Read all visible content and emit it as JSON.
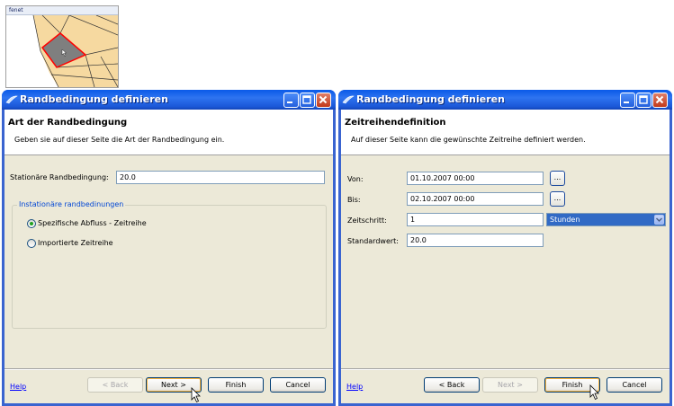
{
  "map": {
    "title": "fenet"
  },
  "colors": {
    "title_bar": "#2e74f0",
    "map_fill": "#f6d9a0",
    "selected_poly": "#7f7f7f",
    "selected_border": "#ff0000"
  },
  "left_dialog": {
    "title": "Randbedingung definieren",
    "header_title": "Art der Randbedingung",
    "header_desc": "Geben sie auf dieser Seite die Art der Randbedingung ein.",
    "stationary_label": "Stationäre Randbedingung:",
    "stationary_value": "20.0",
    "group_label": "Instationäre randbedinungen",
    "radio1": "Spezifische Abfluss - Zeitreihe",
    "radio2": "Importierte Zeitreihe",
    "help": "Help",
    "back": "< Back",
    "next": "Next >",
    "finish": "Finish",
    "cancel": "Cancel"
  },
  "right_dialog": {
    "title": "Randbedingung definieren",
    "header_title": "Zeitreihendefinition",
    "header_desc": "Auf dieser Seite kann die gewünschte Zeitreihe definiert werden.",
    "von_label": "Von:",
    "von_value": "01.10.2007 00:00",
    "bis_label": "Bis:",
    "bis_value": "02.10.2007 00:00",
    "zeitschritt_label": "Zeitschritt:",
    "zeitschritt_value": "1",
    "unit_value": "Stunden",
    "standard_label": "Standardwert:",
    "standard_value": "20.0",
    "dots": "...",
    "help": "Help",
    "back": "< Back",
    "next": "Next >",
    "finish": "Finish",
    "cancel": "Cancel"
  }
}
